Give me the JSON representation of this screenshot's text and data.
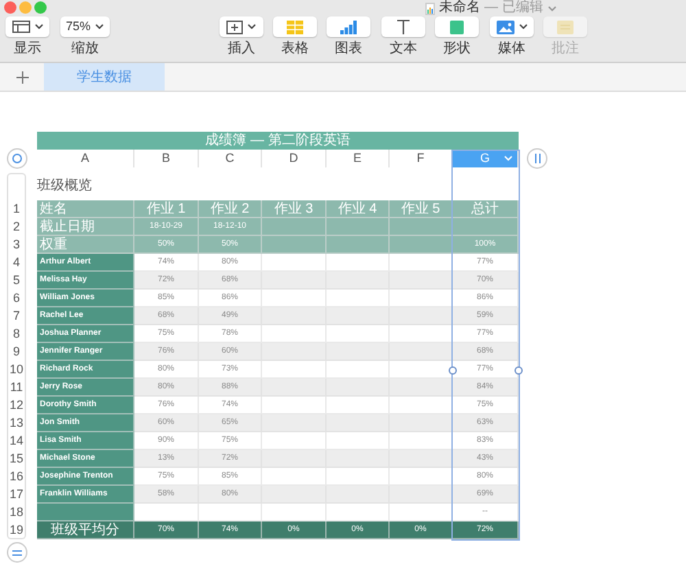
{
  "window": {
    "title": "未命名",
    "status": "— 已编辑"
  },
  "toolbar": {
    "left": [
      {
        "kind": "view",
        "label": "显示"
      },
      {
        "kind": "zoom",
        "label": "缩放",
        "value": "75%"
      }
    ],
    "center": [
      {
        "kind": "insert",
        "label": "插入",
        "disabled": false
      },
      {
        "kind": "table",
        "label": "表格",
        "disabled": false
      },
      {
        "kind": "chart",
        "label": "图表",
        "disabled": false
      },
      {
        "kind": "text",
        "label": "文本",
        "disabled": false
      },
      {
        "kind": "shape",
        "label": "形状",
        "disabled": false
      },
      {
        "kind": "media",
        "label": "媒体",
        "disabled": false
      },
      {
        "kind": "comment",
        "label": "批注",
        "disabled": true
      }
    ]
  },
  "sheet_tabs": [
    {
      "label": "学生数据",
      "selected": true
    }
  ],
  "table": {
    "title": "成绩簿 — 第二阶段英语",
    "caption": "班级概览",
    "columns": [
      {
        "label": "A",
        "selected": false
      },
      {
        "label": "B",
        "selected": false
      },
      {
        "label": "C",
        "selected": false
      },
      {
        "label": "D",
        "selected": false
      },
      {
        "label": "E",
        "selected": false
      },
      {
        "label": "F",
        "selected": false
      },
      {
        "label": "G",
        "selected": true
      }
    ],
    "rows": [
      {
        "kind": "header",
        "number": "1",
        "cells": [
          "姓名",
          "作业 1",
          "作业 2",
          "作业 3",
          "作业 4",
          "作业 5",
          "总计"
        ]
      },
      {
        "kind": "header",
        "number": "2",
        "cells": [
          "截止日期",
          "18-10-29",
          "18-12-10",
          null,
          null,
          null,
          null
        ]
      },
      {
        "kind": "header",
        "number": "3",
        "cells": [
          "权重",
          "50%",
          "50%",
          null,
          null,
          null,
          "100%"
        ]
      },
      {
        "kind": "body",
        "number": "4",
        "cells": [
          "Arthur Albert",
          "74%",
          "80%",
          null,
          null,
          null,
          "77%"
        ]
      },
      {
        "kind": "body",
        "number": "5",
        "cells": [
          "Melissa Hay",
          "72%",
          "68%",
          null,
          null,
          null,
          "70%"
        ]
      },
      {
        "kind": "body",
        "number": "6",
        "cells": [
          "William Jones",
          "85%",
          "86%",
          null,
          null,
          null,
          "86%"
        ]
      },
      {
        "kind": "body",
        "number": "7",
        "cells": [
          "Rachel Lee",
          "68%",
          "49%",
          null,
          null,
          null,
          "59%"
        ]
      },
      {
        "kind": "body",
        "number": "8",
        "cells": [
          "Joshua Planner",
          "75%",
          "78%",
          null,
          null,
          null,
          "77%"
        ]
      },
      {
        "kind": "body",
        "number": "9",
        "cells": [
          "Jennifer Ranger",
          "76%",
          "60%",
          null,
          null,
          null,
          "68%"
        ]
      },
      {
        "kind": "body",
        "number": "10",
        "cells": [
          "Richard Rock",
          "80%",
          "73%",
          null,
          null,
          null,
          "77%"
        ]
      },
      {
        "kind": "body",
        "number": "11",
        "cells": [
          "Jerry Rose",
          "80%",
          "88%",
          null,
          null,
          null,
          "84%"
        ]
      },
      {
        "kind": "body",
        "number": "12",
        "cells": [
          "Dorothy Smith",
          "76%",
          "74%",
          null,
          null,
          null,
          "75%"
        ]
      },
      {
        "kind": "body",
        "number": "13",
        "cells": [
          "Jon Smith",
          "60%",
          "65%",
          null,
          null,
          null,
          "63%"
        ]
      },
      {
        "kind": "body",
        "number": "14",
        "cells": [
          "Lisa Smith",
          "90%",
          "75%",
          null,
          null,
          null,
          "83%"
        ]
      },
      {
        "kind": "body",
        "number": "15",
        "cells": [
          "Michael Stone",
          "13%",
          "72%",
          null,
          null,
          null,
          "43%"
        ]
      },
      {
        "kind": "body",
        "number": "16",
        "cells": [
          "Josephine Trenton",
          "75%",
          "85%",
          null,
          null,
          null,
          "80%"
        ]
      },
      {
        "kind": "body",
        "number": "17",
        "cells": [
          "Franklin Williams",
          "58%",
          "80%",
          null,
          null,
          null,
          "69%"
        ]
      },
      {
        "kind": "body",
        "number": "18",
        "cells": [
          null,
          null,
          null,
          null,
          null,
          null,
          "--"
        ]
      },
      {
        "kind": "footer",
        "number": "19",
        "cells": [
          "班级平均分",
          "70%",
          "74%",
          "0%",
          "0%",
          "0%",
          "72%"
        ]
      }
    ]
  }
}
